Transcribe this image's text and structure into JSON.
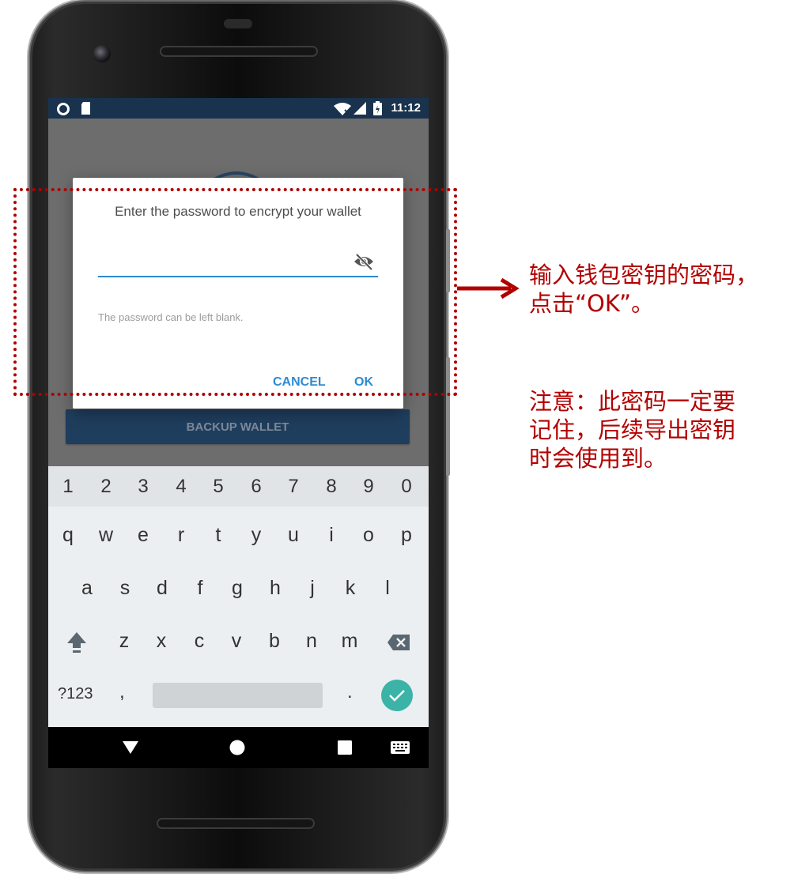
{
  "status_bar": {
    "time": "11:12"
  },
  "dialog": {
    "title": "Enter the password to encrypt your wallet",
    "password_value": "",
    "hint": "The password can be left blank.",
    "cancel_label": "CANCEL",
    "ok_label": "OK"
  },
  "app": {
    "backup_button_label": "BACKUP WALLET"
  },
  "keyboard": {
    "number_row": [
      "1",
      "2",
      "3",
      "4",
      "5",
      "6",
      "7",
      "8",
      "9",
      "0"
    ],
    "row1": [
      "q",
      "w",
      "e",
      "r",
      "t",
      "y",
      "u",
      "i",
      "o",
      "p"
    ],
    "row2": [
      "a",
      "s",
      "d",
      "f",
      "g",
      "h",
      "j",
      "k",
      "l"
    ],
    "row3": [
      "z",
      "x",
      "c",
      "v",
      "b",
      "n",
      "m"
    ],
    "symbols_label": "?123",
    "comma": ",",
    "period": "."
  },
  "annotations": {
    "note1_line1": "输入钱包密钥的密码，",
    "note1_line2": "点击“OK”。",
    "note2_line1": "注意：此密码一定要",
    "note2_line2": "记住，后续导出密钥",
    "note2_line3": "时会使用到。"
  },
  "colors": {
    "accent": "#2d8ad1",
    "status_bar": "#19324d",
    "annotation_red": "#b30000",
    "enter_key": "#3bb3a7"
  }
}
